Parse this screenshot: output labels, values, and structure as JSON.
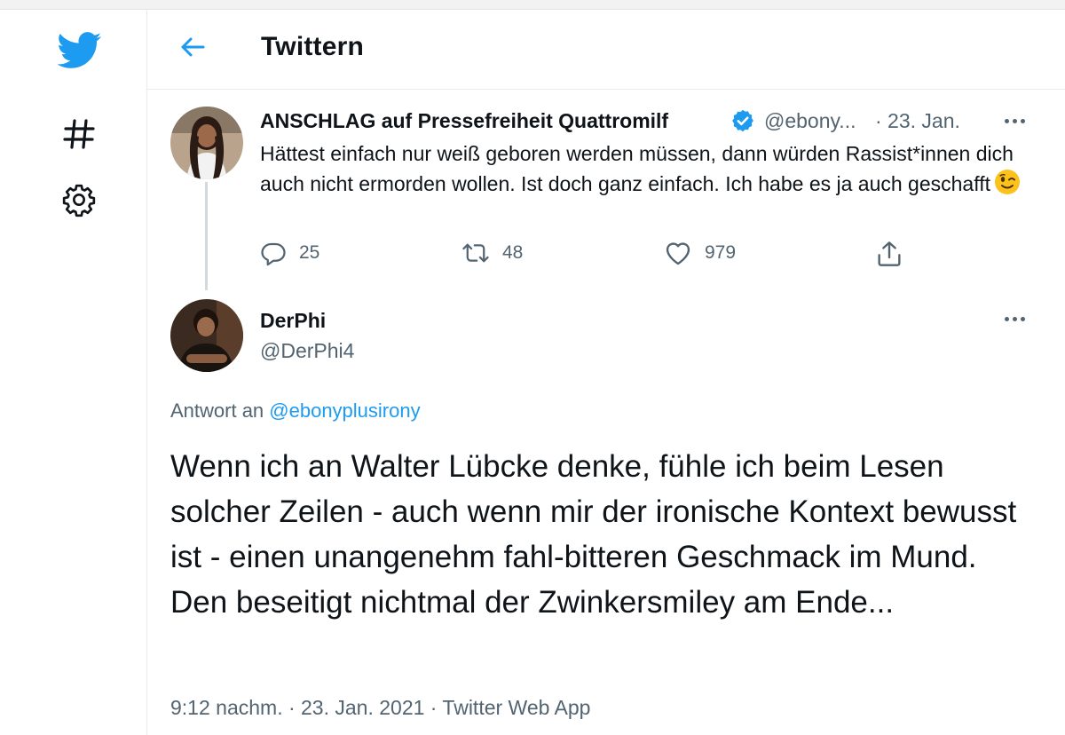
{
  "header": {
    "title": "Twittern"
  },
  "nav": {
    "items": [
      {
        "icon": "twitter-logo-icon"
      },
      {
        "icon": "hashtag-icon"
      },
      {
        "icon": "gear-icon"
      }
    ]
  },
  "colors": {
    "brand_blue": "#1d9bf0",
    "muted": "#536471",
    "divider": "#e6ecf0"
  },
  "parent_tweet": {
    "display_name": "ANSCHLAG auf Pressefreiheit Quattromilf",
    "handle": "@ebony...",
    "date": "· 23. Jan.",
    "verified": true,
    "text": "Hättest einfach nur weiß geboren werden müssen, dann würden Rassist*innen dich auch nicht ermorden wollen. Ist doch ganz einfach. Ich habe es ja auch geschafft",
    "emoji": "winking-face",
    "replies": "25",
    "retweets": "48",
    "likes": "979"
  },
  "main_tweet": {
    "display_name": "DerPhi",
    "handle": "@DerPhi4",
    "reply_prefix": "Antwort an ",
    "reply_to": "@ebonyplusirony",
    "text": "Wenn ich an Walter Lübcke denke, fühle ich beim Lesen solcher Zeilen - auch wenn mir der ironische Kontext bewusst ist - einen unangenehm fahl-bitteren Geschmack im Mund. Den beseitigt nichtmal der Zwinkersmiley am Ende...",
    "timestamp": "9:12 nachm. · 23. Jan. 2021 · Twitter Web App"
  }
}
